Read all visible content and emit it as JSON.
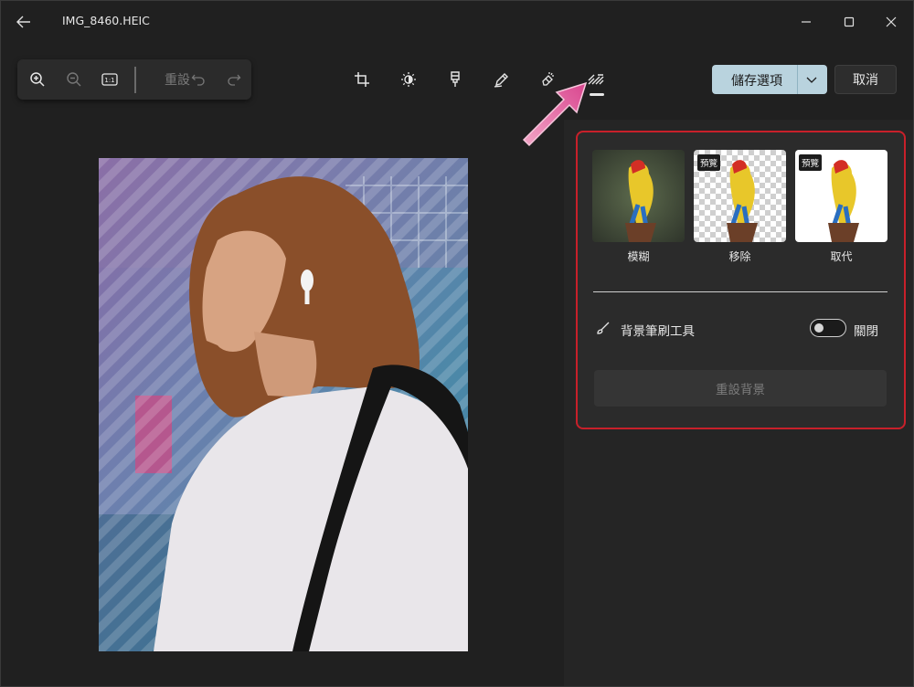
{
  "window": {
    "title": "IMG_8460.HEIC"
  },
  "zoombar": {
    "reset_label": "重設"
  },
  "actions": {
    "save_label": "儲存選項",
    "cancel_label": "取消"
  },
  "background_panel": {
    "options": [
      {
        "label": "模糊",
        "badge": ""
      },
      {
        "label": "移除",
        "badge": "預覽"
      },
      {
        "label": "取代",
        "badge": "預覽"
      }
    ],
    "brush_tool_label": "背景筆刷工具",
    "toggle_state_label": "關閉",
    "toggle_on": false,
    "reset_background_label": "重設背景"
  },
  "colors": {
    "accent_button": "#b9d3de",
    "highlight_box": "#c8202a",
    "annotation_arrow": "#d9468f"
  }
}
